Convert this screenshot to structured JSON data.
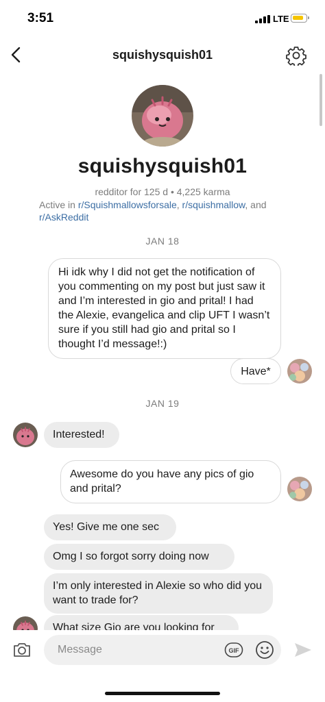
{
  "status_bar": {
    "time": "3:51",
    "network": "LTE"
  },
  "header": {
    "username": "squishysquish01"
  },
  "profile": {
    "name": "squishysquish01",
    "meta": "redditor for 125 d • 4,225 karma",
    "active_in_prefix": "Active in ",
    "communities": [
      "r/Squishmallowsforsale",
      "r/squishmallow",
      "r/AskReddit"
    ],
    "sep1": ", ",
    "sep2": ", and"
  },
  "messages": {
    "date_1": "JAN 18",
    "sent_1": "Hi idk why I did not get the notification of you commenting on my post but just saw it and I’m interested in gio and prital! I had the Alexie, evangelica and clip UFT I wasn’t sure if you still had gio and prital so I thought I’d message!:)",
    "sent_2": "Have*",
    "date_2": "JAN 19",
    "received_1": "Interested!",
    "sent_3": "Awesome do you have any pics of gio and prital?",
    "received_2": "Yes! Give me one sec",
    "received_3": "Omg I so forgot sorry doing now",
    "received_4": "I’m only interested in Alexie so who did you want to trade for?",
    "received_5": "What size Gio are you looking for"
  },
  "composer": {
    "placeholder": "Message",
    "gif_label": "GIF"
  },
  "colors": {
    "link": "#3c6ea4",
    "bubble_in": "#ececec",
    "battery": "#f5c400"
  }
}
